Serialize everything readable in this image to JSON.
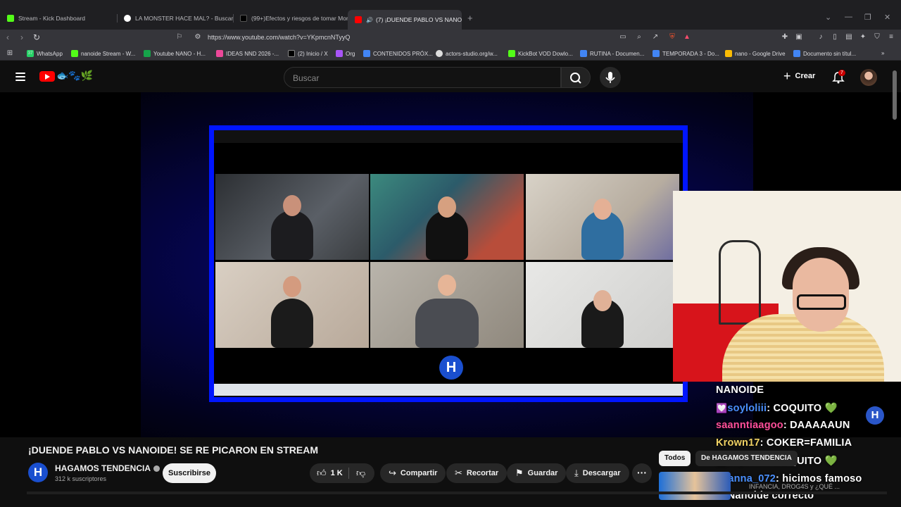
{
  "browser": {
    "tabs": [
      {
        "label": "Stream - Kick Dashboard",
        "icon": "kick-icon",
        "color": "#53fc18"
      },
      {
        "label": "LA MONSTER HACE MAL? - Buscar c",
        "icon": "google-icon",
        "color": "#ffffff"
      },
      {
        "label": "(99+)Efectos y riesgos de tomar Mon",
        "icon": "tiktok-icon",
        "color": "#000000"
      },
      {
        "label": "(7) ¡DUENDE PABLO VS NANOI",
        "icon": "youtube-icon",
        "color": "#ff0000"
      }
    ],
    "url": "https://www.youtube.com/watch?v=YKpmcnNTyyQ",
    "bookmarks": [
      {
        "label": "WhatsApp",
        "badge": "37",
        "color": "#25d366"
      },
      {
        "label": "nanoide Stream - W...",
        "color": "#53fc18"
      },
      {
        "label": "Youtube NANO - H...",
        "color": "#16a34a"
      },
      {
        "label": "IDEAS NND 2026 -...",
        "color": "#ec4899"
      },
      {
        "label": "(2) Inicio / X",
        "color": "#000000"
      },
      {
        "label": "Org",
        "color": "#a855f7"
      },
      {
        "label": "CONTENIDOS PRÓX...",
        "color": "#4285f4"
      },
      {
        "label": "actors-studio.org/w...",
        "color": "#ffffff"
      },
      {
        "label": "KickBot VOD Dowlo...",
        "color": "#53fc18"
      },
      {
        "label": "RUTINA - Documen...",
        "color": "#4285f4"
      },
      {
        "label": "TEMPORADA 3 - Do...",
        "color": "#4285f4"
      },
      {
        "label": "nano - Google Drive",
        "color": "#fbbc04"
      },
      {
        "label": "Documento sin títul...",
        "color": "#4285f4"
      }
    ]
  },
  "youtube": {
    "search_placeholder": "Buscar",
    "create_label": "Crear",
    "notifications_count": "7"
  },
  "video": {
    "title": "¡DUENDE PABLO VS NANOIDE! SE RE PICARON EN STREAM",
    "channel_name": "HAGAMOS TENDENCIA",
    "subscribers": "312 k suscriptores",
    "subscribe_label": "Suscribirse",
    "likes": "1 K",
    "share_label": "Compartir",
    "clip_label": "Recortar",
    "save_label": "Guardar",
    "download_label": "Descargar",
    "logo_glyph": "H"
  },
  "chat": {
    "lines": [
      {
        "user": "NANOIDE",
        "message": "",
        "user_color": "#ffffff",
        "heart": false
      },
      {
        "user": "soyloliii",
        "message": "COQUITO",
        "user_color": "#4a90ff",
        "heart": true,
        "green_heart": true
      },
      {
        "user": "saanntiaagoo",
        "message": "DAAAAAUN",
        "user_color": "#ff4f9a",
        "heart": false
      },
      {
        "user": "Krown17",
        "message": "COKER=FAMILIA",
        "user_color": "#f0d264",
        "heart": false
      },
      {
        "user": "soyloliii",
        "message": "COQUITO",
        "user_color": "#4a90ff",
        "heart": true,
        "green_heart": true
      },
      {
        "user": "cuanna_072",
        "message": "hicimos famoso",
        "user_color": "#4a90ff",
        "heart": false
      },
      {
        "user": "",
        "message": "al Nanoide correcto",
        "user_color": "#ffffff",
        "heart": false
      }
    ]
  },
  "sidebar": {
    "chips": [
      "Todos",
      "De HAGAMOS TENDENCIA"
    ],
    "rec_title": "INFANCIA, DROG4S y ¿QUÉ ..."
  }
}
